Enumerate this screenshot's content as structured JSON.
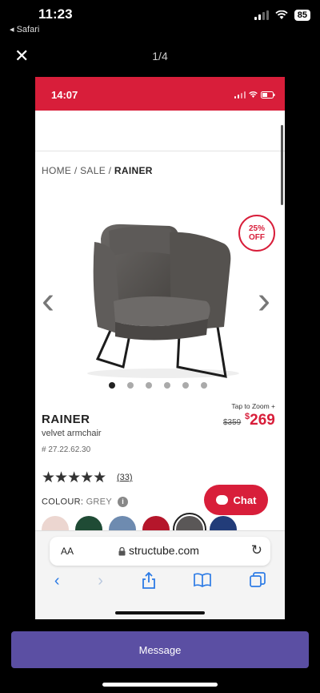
{
  "outer_status": {
    "time": "11:23",
    "back_app": "◂ Safari",
    "battery": "85"
  },
  "viewer": {
    "counter": "1/4",
    "close_icon": "close-icon"
  },
  "inner_status": {
    "time": "14:07"
  },
  "breadcrumb": {
    "home": "HOME",
    "sep1": " / ",
    "sale": "SALE",
    "sep2": " / ",
    "current": "RAINER"
  },
  "product": {
    "discount_badge_pct": "25%",
    "discount_badge_off": "OFF",
    "tap_to_zoom": "Tap to Zoom +",
    "name": "RAINER",
    "subtitle": "velvet armchair",
    "sku": "# 27.22.62.30",
    "old_price": "$359",
    "new_price_currency": "$",
    "new_price": "269",
    "rating_stars": "★★★★★",
    "rating_value": 5,
    "review_count": "(33)",
    "colour_label": "COLOUR:",
    "colour_value": "GREY",
    "gallery_total": 6,
    "gallery_current": 1
  },
  "swatches": [
    {
      "name": "blush",
      "color": "#ecd6d0"
    },
    {
      "name": "green",
      "color": "#1f4b35"
    },
    {
      "name": "blue",
      "color": "#6e8bb0"
    },
    {
      "name": "red",
      "color": "#b5162b"
    },
    {
      "name": "grey",
      "color": "#5a5757",
      "selected": true
    },
    {
      "name": "navy",
      "color": "#223c79"
    }
  ],
  "chat": {
    "label": "Chat"
  },
  "safari": {
    "aa": "AA",
    "url": "structube.com"
  },
  "message_button": {
    "label": "Message"
  },
  "colors": {
    "brand_red": "#d81e3a",
    "message_purple": "#5b4fa3",
    "safari_blue": "#2c7be5"
  }
}
